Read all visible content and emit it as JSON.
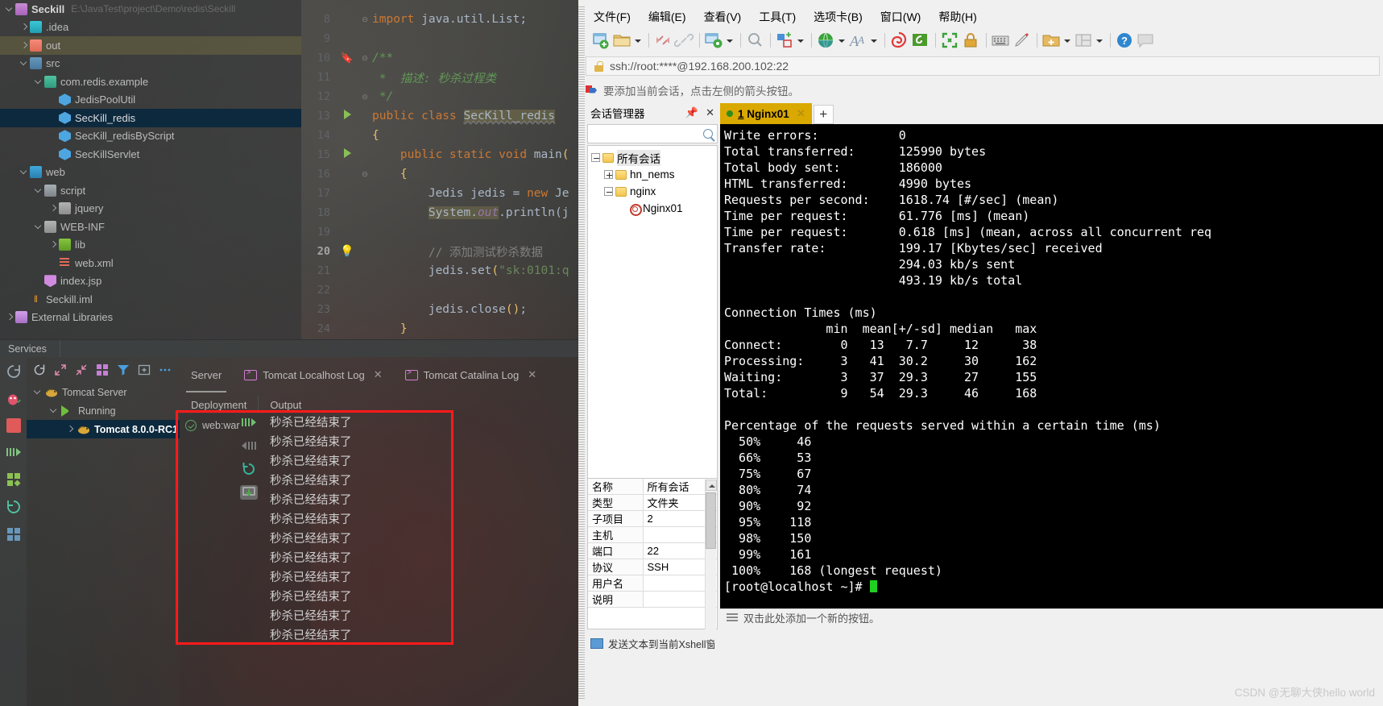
{
  "ide": {
    "project": {
      "name": "Seckill",
      "path": "E:\\JavaTest\\project\\Demo\\redis\\Seckill",
      "items": [
        {
          "label": ".idea",
          "icon": "folder-idea-icon",
          "indent": 1,
          "chevron": "right",
          "state": "normal"
        },
        {
          "label": "out",
          "icon": "folder-out-icon",
          "indent": 1,
          "chevron": "right",
          "state": "highlight"
        },
        {
          "label": "src",
          "icon": "source-folder-icon",
          "indent": 1,
          "chevron": "down",
          "state": "normal"
        },
        {
          "label": "com.redis.example",
          "icon": "package-icon",
          "indent": 2,
          "chevron": "down",
          "state": "normal"
        },
        {
          "label": "JedisPoolUtil",
          "icon": "java-class-icon",
          "indent": 3,
          "chevron": "none",
          "state": "normal"
        },
        {
          "label": "SecKill_redis",
          "icon": "java-class-runnable-icon",
          "indent": 3,
          "chevron": "none",
          "state": "selected"
        },
        {
          "label": "SecKill_redisByScript",
          "icon": "java-class-runnable-icon",
          "indent": 3,
          "chevron": "none",
          "state": "normal"
        },
        {
          "label": "SecKillServlet",
          "icon": "java-class-icon",
          "indent": 3,
          "chevron": "none",
          "state": "normal"
        },
        {
          "label": "web",
          "icon": "web-folder-icon",
          "indent": 1,
          "chevron": "down",
          "state": "normal"
        },
        {
          "label": "script",
          "icon": "script-folder-icon",
          "indent": 2,
          "chevron": "down",
          "state": "normal"
        },
        {
          "label": "jquery",
          "icon": "folder-icon",
          "indent": 3,
          "chevron": "right",
          "state": "normal"
        },
        {
          "label": "WEB-INF",
          "icon": "folder-icon",
          "indent": 2,
          "chevron": "down",
          "state": "normal"
        },
        {
          "label": "lib",
          "icon": "library-folder-icon",
          "indent": 3,
          "chevron": "right",
          "state": "normal"
        },
        {
          "label": "web.xml",
          "icon": "xml-file-icon",
          "indent": 3,
          "chevron": "none",
          "state": "normal"
        },
        {
          "label": "index.jsp",
          "icon": "jsp-file-icon",
          "indent": 2,
          "chevron": "none",
          "state": "normal"
        },
        {
          "label": "Seckill.iml",
          "icon": "iml-file-icon",
          "indent": 1,
          "chevron": "none",
          "state": "normal"
        },
        {
          "label": "External Libraries",
          "icon": "external-libraries-icon",
          "indent": 0,
          "chevron": "right",
          "state": "normal"
        }
      ]
    },
    "editor": {
      "lines": [
        {
          "num": "8",
          "text": "import java.util.List;"
        },
        {
          "num": "9",
          "text": ""
        },
        {
          "num": "10",
          "text": "/**"
        },
        {
          "num": "11",
          "text": " *  描述: 秒杀过程类"
        },
        {
          "num": "12",
          "text": " */"
        },
        {
          "num": "13",
          "text": "public class SecKill_redis"
        },
        {
          "num": "14",
          "text": "{"
        },
        {
          "num": "15",
          "text": "    public static void main("
        },
        {
          "num": "16",
          "text": "    {"
        },
        {
          "num": "17",
          "text": "        Jedis jedis = new Je"
        },
        {
          "num": "18",
          "text": "        System.out.println(j"
        },
        {
          "num": "19",
          "text": ""
        },
        {
          "num": "20",
          "text": "        // 添加测试秒杀数据"
        },
        {
          "num": "21",
          "text": "        jedis.set(\"sk:0101:q"
        },
        {
          "num": "22",
          "text": ""
        },
        {
          "num": "23",
          "text": "        jedis.close();"
        },
        {
          "num": "24",
          "text": "    }"
        }
      ]
    },
    "services": {
      "tool_window_label": "Services",
      "toolbar_icons": [
        "rerun-icon",
        "expand-all-icon",
        "collapse-all-icon",
        "group-icon",
        "filter-icon",
        "add-config-icon",
        "more-options-icon"
      ],
      "left_rail_icons": [
        "rerun-icon",
        "debug-icon",
        "stop-icon",
        "resume-icon",
        "modules-icon",
        "redeploy-icon",
        "dashboard-icon"
      ],
      "tree": [
        {
          "label": "Tomcat Server",
          "indent": 0,
          "chevron": "down",
          "icon": "tomcat-icon",
          "state": "normal"
        },
        {
          "label": "Running",
          "indent": 1,
          "chevron": "down",
          "icon": "run-triangle-icon",
          "state": "normal"
        },
        {
          "label": "Tomcat 8.0.0-RC1",
          "indent": 2,
          "chevron": "right",
          "icon": "tomcat-icon",
          "state": "selected"
        }
      ],
      "tabs": [
        {
          "label": "Server",
          "icon": "",
          "closable": false,
          "active": true
        },
        {
          "label": "Tomcat Localhost Log",
          "icon": "terminal-icon",
          "closable": true,
          "active": false
        },
        {
          "label": "Tomcat Catalina Log",
          "icon": "terminal-icon",
          "closable": true,
          "active": false
        }
      ],
      "subtabs": [
        {
          "label": "Deployment",
          "active": true
        },
        {
          "label": "Output",
          "active": false
        }
      ],
      "deployment": {
        "artifact": "web:war",
        "status_icon": "success-check-icon"
      },
      "deployment_action_icons": [
        "resume-icon",
        "pause-icon",
        "redeploy-icon",
        "scroll-to-end-icon"
      ],
      "output_lines": [
        "秒杀已经结束了",
        "秒杀已经结束了",
        "秒杀已经结束了",
        "秒杀已经结束了",
        "秒杀已经结束了",
        "秒杀已经结束了",
        "秒杀已经结束了",
        "秒杀已经结束了",
        "秒杀已经结束了",
        "秒杀已经结束了",
        "秒杀已经结束了",
        "秒杀已经结束了"
      ],
      "highlight_color": "#ff1a1a"
    }
  },
  "xshell": {
    "menu": [
      "文件(F)",
      "编辑(E)",
      "查看(V)",
      "工具(T)",
      "选项卡(B)",
      "窗口(W)",
      "帮助(H)"
    ],
    "toolbar_icons": [
      "new-session-icon",
      "open-folder-icon",
      "open-folder-caret",
      "disconnect-icon",
      "connect-icon",
      "session-properties-icon",
      "session-properties-caret",
      "find-icon",
      "transfer-file-icon",
      "transfer-file-caret",
      "globe-icon",
      "globe-caret",
      "font-icon",
      "font-caret",
      "xftp-icon",
      "xagent-icon",
      "fullscreen-icon",
      "lock-icon",
      "keyboard-icon",
      "highlight-icon",
      "add-folder-icon",
      "add-folder-caret",
      "layout-icon",
      "layout-caret",
      "help-icon",
      "feedback-icon"
    ],
    "address": "ssh://root:****@192.168.200.102:22",
    "hint": "要添加当前会话，点击左侧的箭头按钮。",
    "session_manager": {
      "title": "会话管理器",
      "pin_icon": "pin-icon",
      "close_icon": "close-icon",
      "search_placeholder": "",
      "search_icon": "search-icon",
      "tree": [
        {
          "label": "所有会话",
          "indent": 0,
          "expander": "minus",
          "icon": "all-sessions-icon",
          "selected": true
        },
        {
          "label": "hn_nems",
          "indent": 1,
          "expander": "plus",
          "icon": "folder-icon",
          "selected": false
        },
        {
          "label": "nginx",
          "indent": 1,
          "expander": "minus",
          "icon": "folder-icon",
          "selected": false
        },
        {
          "label": "Nginx01",
          "indent": 2,
          "expander": "none",
          "icon": "session-icon",
          "selected": false
        }
      ],
      "properties": [
        {
          "key": "名称",
          "value": "所有会话"
        },
        {
          "key": "类型",
          "value": "文件夹"
        },
        {
          "key": "子项目",
          "value": "2"
        },
        {
          "key": "主机",
          "value": ""
        },
        {
          "key": "端口",
          "value": "22"
        },
        {
          "key": "协议",
          "value": "SSH"
        },
        {
          "key": "用户名",
          "value": ""
        },
        {
          "key": "说明",
          "value": ""
        }
      ]
    },
    "tab": {
      "index": "1",
      "label": "Nginx01",
      "status_dot_color": "#2e8b1f",
      "tab_color": "#d9a900",
      "close_icon": "close-icon"
    },
    "new_tab_label": "+",
    "terminal_text": "Write errors:           0\nTotal transferred:      125990 bytes\nTotal body sent:        186000\nHTML transferred:       4990 bytes\nRequests per second:    1618.74 [#/sec] (mean)\nTime per request:       61.776 [ms] (mean)\nTime per request:       0.618 [ms] (mean, across all concurrent req\nTransfer rate:          199.17 [Kbytes/sec] received\n                        294.03 kb/s sent\n                        493.19 kb/s total\n\nConnection Times (ms)\n              min  mean[+/-sd] median   max\nConnect:        0   13   7.7     12      38\nProcessing:     3   41  30.2     30     162\nWaiting:        3   37  29.3     27     155\nTotal:          9   54  29.3     46     168\n\nPercentage of the requests served within a certain time (ms)\n  50%     46\n  66%     53\n  75%     67\n  80%     74\n  90%     92\n  95%    118\n  98%    150\n  99%    161\n 100%    168 (longest request)\n[root@localhost ~]# ",
    "terminal_bottom_hint": "双击此处添加一个新的按钮。",
    "status_hint": "发送文本到当前Xshell窗口的全部会话"
  },
  "watermark": "CSDN @无聊大侠hello world"
}
